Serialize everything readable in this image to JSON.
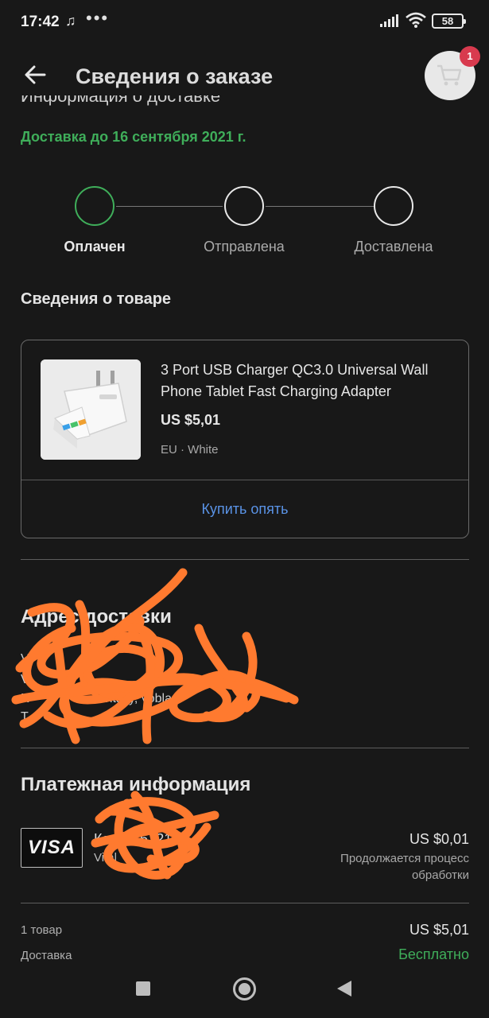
{
  "status_bar": {
    "time": "17:42",
    "music_icon": "♫",
    "dots": "•••",
    "battery": "58"
  },
  "header": {
    "title": "Сведения о заказе",
    "cart_badge": "1"
  },
  "partial_heading": "Информация о доставке",
  "delivery": {
    "date_text": "Доставка до 16 сентября 2021 г."
  },
  "steps": [
    {
      "label": "Оплачен",
      "active": true
    },
    {
      "label": "Отправлена",
      "active": false
    },
    {
      "label": "Доставлена",
      "active": false
    }
  ],
  "product_section": {
    "title": "Сведения о товаре",
    "name": "3 Port USB Charger QC3.0 Universal Wall Phone Tablet Fast Charging Adapter",
    "price": "US $5,01",
    "variant": "EU · White",
    "buy_again": "Купить опять"
  },
  "address_section": {
    "title": "Адрес доставки",
    "line1": "Vi",
    "line2": "Vi",
    "line3": "N",
    "line3b": "vitaliy, vobla",
    "line4": "T"
  },
  "payment_section": {
    "title": "Платежная информация",
    "card_brand": "VISA",
    "card_label": "Карта: 6721",
    "card_holder": "Vital",
    "amount": "US $0,01",
    "status": "Продолжается процесс обработки"
  },
  "summary": {
    "items_label": "1 товар",
    "items_value": "US $5,01",
    "delivery_label": "Доставка",
    "delivery_value": "Бесплатно"
  },
  "colors": {
    "background": "#181818",
    "accent_green": "#3fae5a",
    "link_blue": "#5a93e6",
    "badge_red": "#d83a4e",
    "scribble_orange": "#ff7a2f"
  }
}
